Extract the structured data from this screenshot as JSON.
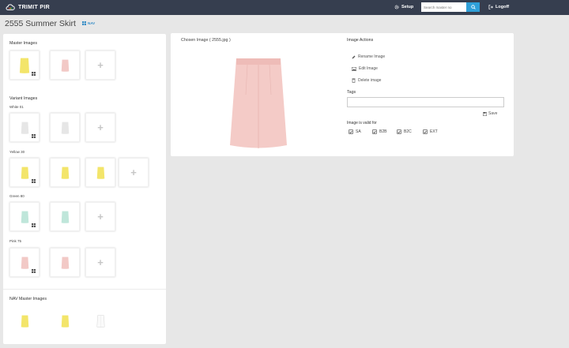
{
  "app": {
    "brand": "TRIMIT PIR",
    "nav": {
      "setup": "Setup",
      "logoff": "Logoff"
    },
    "search": {
      "placeholder": "Search master no",
      "value": ""
    }
  },
  "page": {
    "title": "2555 Summer Skirt",
    "badge": "NAV"
  },
  "left": {
    "master_label": "Master Images",
    "variant_label": "Variant Images",
    "variants": [
      {
        "label": "White 01"
      },
      {
        "label": "Yellow 30"
      },
      {
        "label": "Green 80"
      },
      {
        "label": "Pink 75"
      }
    ],
    "nav_master_label": "NAV Master Images",
    "add_symbol": "+"
  },
  "main": {
    "chosen_image": "Chosen Image ( 2555.jpg )",
    "actions_title": "Image Actions",
    "actions": [
      "Rename Image",
      "Edit Image",
      "Delete image"
    ],
    "tags_label": "Tags",
    "tags_value": "",
    "save": "Save",
    "valid_label": "Image is valid for",
    "valid_for": [
      "SA",
      "B2B",
      "B2C",
      "EXT"
    ]
  },
  "colors": {
    "topbar": "#363e4f",
    "accent": "#2f9fd8",
    "yellow": "#f3e56a",
    "pink": "#f2c9c6",
    "green": "#bfe6da",
    "white_garment": "#e6e6e6"
  },
  "icons": [
    "cloud-logo-icon",
    "gear-icon",
    "search-icon",
    "logoff-icon",
    "windows-icon",
    "pencil-icon",
    "image-icon",
    "trash-icon",
    "save-icon",
    "checkbox-icon",
    "plus-icon"
  ]
}
